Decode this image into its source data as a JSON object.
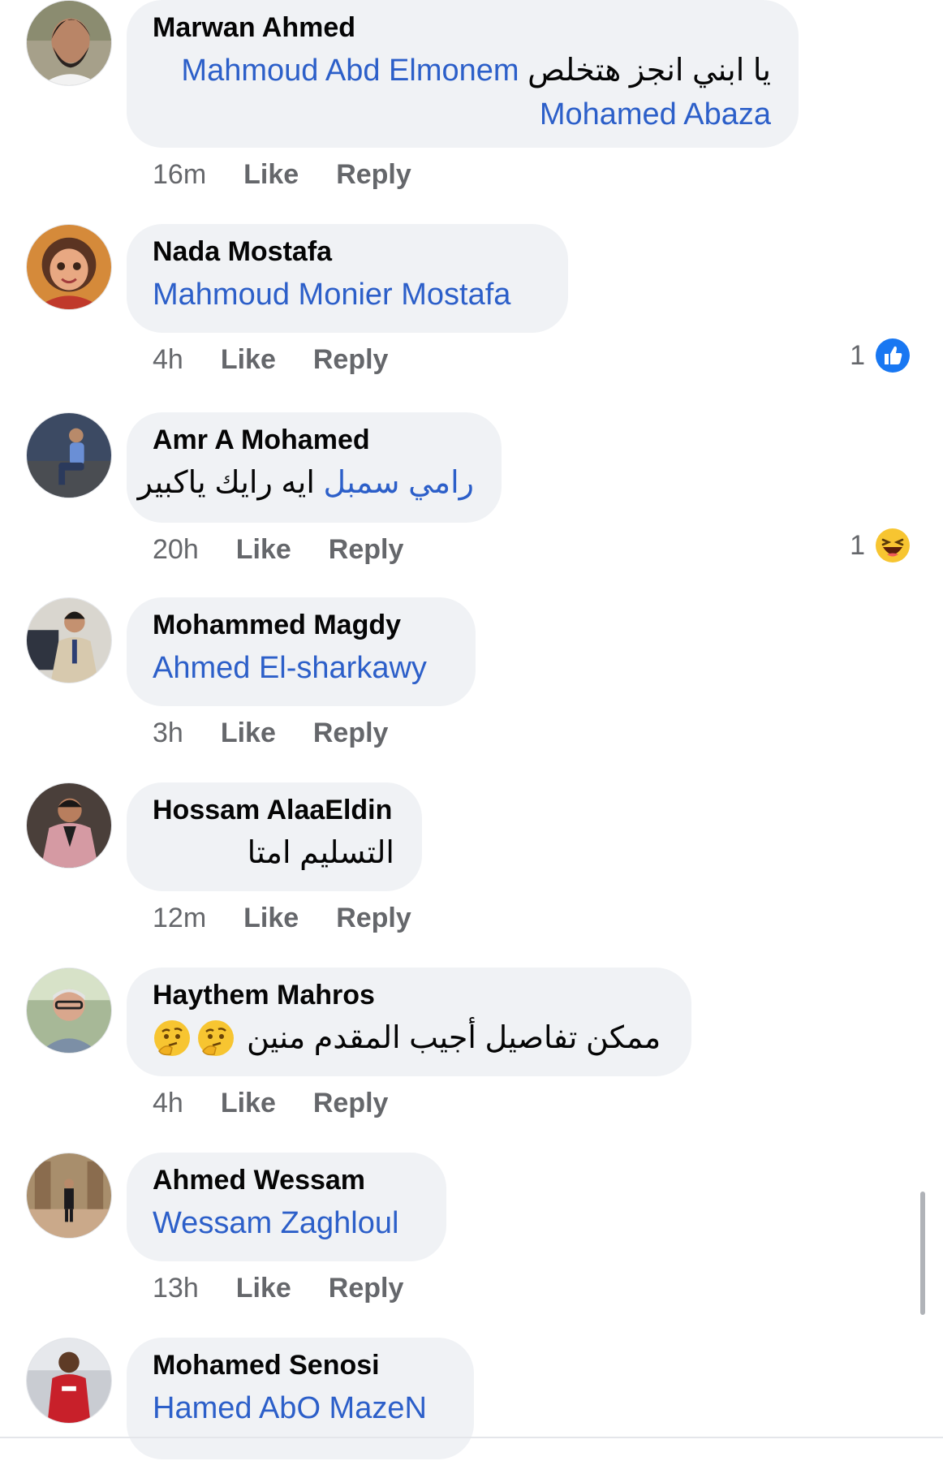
{
  "comments": [
    {
      "author": "Marwan Ahmed",
      "mention1": "Mahmoud Abd Elmonem",
      "text1": "يا ابني انجز هتخلص",
      "mention2": "Mohamed Abaza",
      "time": "16m",
      "like": "Like",
      "reply": "Reply"
    },
    {
      "author": "Nada Mostafa",
      "mention1": "Mahmoud Monier Mostafa",
      "time": "4h",
      "like": "Like",
      "reply": "Reply",
      "reaction_count": "1",
      "reaction_icon": "like-reaction-icon"
    },
    {
      "author": "Amr A Mohamed",
      "mention1": "رامي سمبل",
      "text1": "ايه رايك ياكبير",
      "time": "20h",
      "like": "Like",
      "reply": "Reply",
      "reaction_count": "1",
      "reaction_icon": "haha-reaction-icon"
    },
    {
      "author": "Mohammed Magdy",
      "mention1": "Ahmed El-sharkawy",
      "time": "3h",
      "like": "Like",
      "reply": "Reply"
    },
    {
      "author": "Hossam AlaaEldin",
      "text1": "التسليم امتا",
      "time": "12m",
      "like": "Like",
      "reply": "Reply"
    },
    {
      "author": "Haythem Mahros",
      "text1": "ممكن تفاصيل أجيب المقدم منين",
      "emoji": "thinking-face-icon",
      "time": "4h",
      "like": "Like",
      "reply": "Reply"
    },
    {
      "author": "Ahmed Wessam",
      "mention1": "Wessam Zaghloul",
      "time": "13h",
      "like": "Like",
      "reply": "Reply"
    },
    {
      "author": "Mohamed Senosi",
      "mention1": "Hamed AbO MazeN"
    }
  ],
  "colors": {
    "bubble": "#f0f2f5",
    "mention": "#2c5fc9",
    "meta": "#65676b",
    "like_blue": "#1877f2",
    "haha_yellow": "#f7c531"
  }
}
